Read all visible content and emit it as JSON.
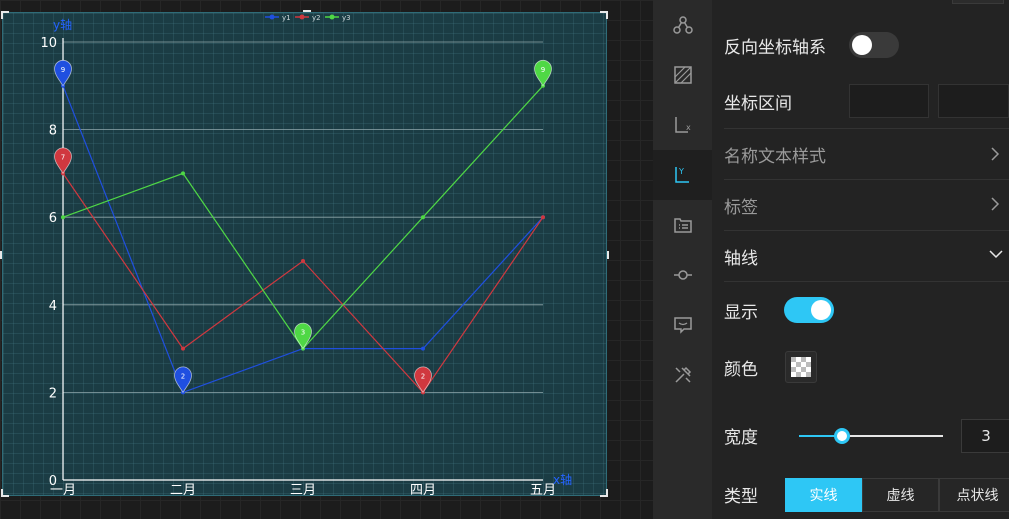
{
  "colors": {
    "accent": "#2ec7f5",
    "y1": "#1f4fe0",
    "y2": "#d0383f",
    "y3": "#4fd845",
    "axis_label": "#2463ff"
  },
  "chart_data": {
    "type": "line",
    "categories": [
      "一月",
      "二月",
      "三月",
      "四月",
      "五月"
    ],
    "series": [
      {
        "name": "y1",
        "values": [
          9,
          2,
          3,
          3,
          6
        ]
      },
      {
        "name": "y2",
        "values": [
          7,
          3,
          5,
          2,
          6
        ]
      },
      {
        "name": "y3",
        "values": [
          6,
          7,
          3,
          6,
          9
        ]
      }
    ],
    "markers": [
      {
        "series": "y1",
        "index": 0,
        "label": "9"
      },
      {
        "series": "y1",
        "index": 1,
        "label": "2"
      },
      {
        "series": "y2",
        "index": 0,
        "label": "7"
      },
      {
        "series": "y2",
        "index": 3,
        "label": "2"
      },
      {
        "series": "y3",
        "index": 2,
        "label": "3"
      },
      {
        "series": "y3",
        "index": 4,
        "label": "9"
      }
    ],
    "ylim": [
      0,
      10
    ],
    "yticks": [
      0,
      2,
      4,
      6,
      8,
      10
    ],
    "xlabel": "x轴",
    "ylabel": "y轴",
    "legend": "top-center",
    "grid": true
  },
  "rail": {
    "icons": [
      "nodes-icon",
      "pattern-icon",
      "x-axis-icon",
      "y-axis-icon",
      "list-icon",
      "line-node-icon",
      "tooltip-icon",
      "tools-icon"
    ],
    "active": 3,
    "x_axis_glyph": "x",
    "y_axis_glyph": "Y"
  },
  "panel": {
    "reverse_axis_label": "反向坐标轴系",
    "reverse_axis_on": false,
    "range_label": "坐标区间",
    "name_style_label": "名称文本样式",
    "tick_label_label": "标签",
    "axis_line_label": "轴线",
    "show_label": "显示",
    "show_on": true,
    "color_label": "颜色",
    "width_label": "宽度",
    "width_value": "3",
    "width_fraction": 0.3,
    "type_label": "类型",
    "type_options": [
      "实线",
      "虚线",
      "点状线"
    ],
    "type_selected": 0
  }
}
